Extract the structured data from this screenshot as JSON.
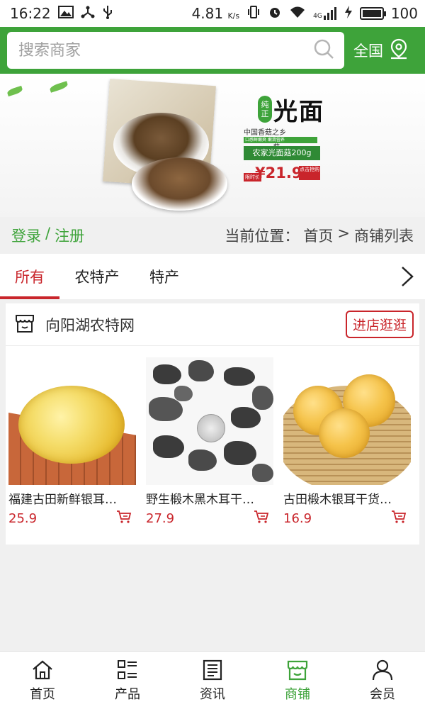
{
  "status_bar": {
    "time": "16:22",
    "speed": "4.81",
    "speed_unit": "K/s",
    "network": "4G",
    "battery": "100"
  },
  "header": {
    "search_placeholder": "搜索商家",
    "region_label": "全国"
  },
  "banner": {
    "badge_chars": [
      "纯",
      "正"
    ],
    "title": "光面",
    "title_suffix": "菇",
    "origin": "中国香菇之乡",
    "tagline": "口感鲜嫩爽 嫩滑营养",
    "product_name": "农家光面菇200g",
    "price_tag": "限时价",
    "price": "¥21.9",
    "buy_label": "点击抢购"
  },
  "location_bar": {
    "login": "登录",
    "separator": "/",
    "register": "注册",
    "prefix": "当前位置：",
    "home": "首页",
    "arrow": ">",
    "current": "商铺列表"
  },
  "tabs": [
    {
      "label": "所有",
      "active": true
    },
    {
      "label": "农特产",
      "active": false
    },
    {
      "label": "特产",
      "active": false
    }
  ],
  "shop": {
    "name": "向阳湖农特网",
    "visit_label": "进店逛逛",
    "products": [
      {
        "name": "福建古田新鲜银耳…",
        "price": "25.9"
      },
      {
        "name": "野生椴木黑木耳干…",
        "price": "27.9"
      },
      {
        "name": "古田椴木银耳干货…",
        "price": "16.9"
      }
    ]
  },
  "bottom_nav": [
    {
      "label": "首页",
      "icon": "home-icon",
      "active": false
    },
    {
      "label": "产品",
      "icon": "grid-list-icon",
      "active": false
    },
    {
      "label": "资讯",
      "icon": "news-icon",
      "active": false
    },
    {
      "label": "商铺",
      "icon": "store-icon",
      "active": true
    },
    {
      "label": "会员",
      "icon": "user-icon",
      "active": false
    }
  ],
  "colors": {
    "brand_green": "#3ea33a",
    "accent_red": "#c9252b"
  }
}
